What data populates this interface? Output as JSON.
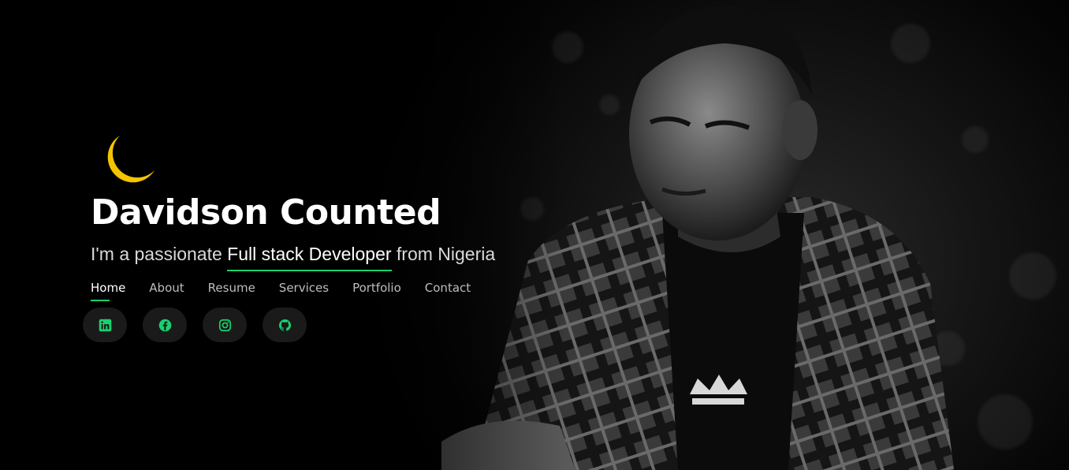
{
  "hero": {
    "name": "Davidson Counted",
    "tagline_prefix": "I'm a passionate ",
    "tagline_typed": "Full stack Developer",
    "tagline_suffix": " from Nigeria"
  },
  "theme_toggle": {
    "icon": "moon-icon",
    "color": "#f5c400"
  },
  "nav": {
    "items": [
      {
        "label": "Home",
        "active": true
      },
      {
        "label": "About"
      },
      {
        "label": "Resume"
      },
      {
        "label": "Services"
      },
      {
        "label": "Portfolio"
      },
      {
        "label": "Contact"
      }
    ]
  },
  "social": {
    "accent": "#18d26e",
    "links": [
      {
        "icon": "linkedin-icon"
      },
      {
        "icon": "facebook-icon"
      },
      {
        "icon": "instagram-icon"
      },
      {
        "icon": "github-icon"
      }
    ]
  }
}
